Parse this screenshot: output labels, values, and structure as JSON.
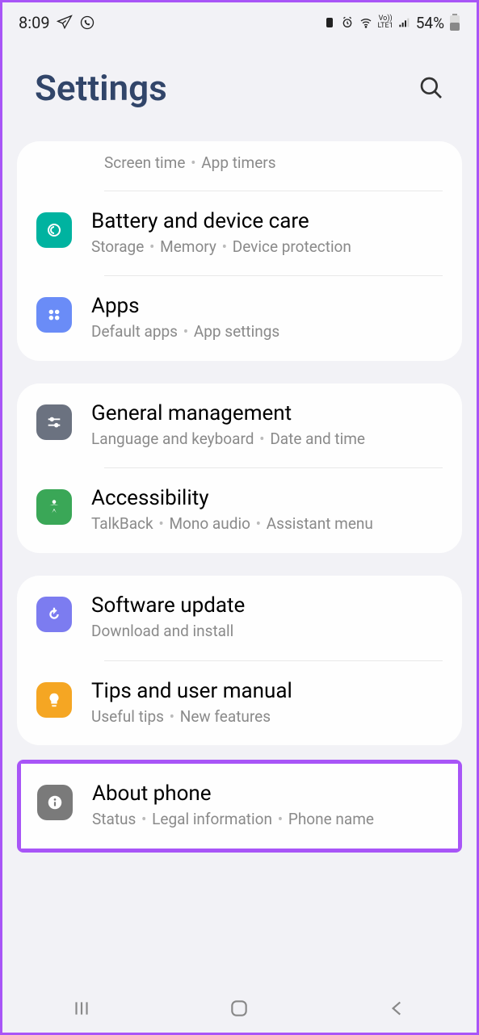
{
  "status": {
    "time": "8:09",
    "battery": "54%",
    "lte": "LTE1",
    "vo": "Vo))"
  },
  "header": {
    "title": "Settings"
  },
  "group1": {
    "digital": {
      "sub1": "Screen time",
      "sub2": "App timers"
    },
    "battery": {
      "title": "Battery and device care",
      "sub1": "Storage",
      "sub2": "Memory",
      "sub3": "Device protection"
    },
    "apps": {
      "title": "Apps",
      "sub1": "Default apps",
      "sub2": "App settings"
    }
  },
  "group2": {
    "general": {
      "title": "General management",
      "sub1": "Language and keyboard",
      "sub2": "Date and time"
    },
    "accessibility": {
      "title": "Accessibility",
      "sub1": "TalkBack",
      "sub2": "Mono audio",
      "sub3": "Assistant menu"
    }
  },
  "group3": {
    "software": {
      "title": "Software update",
      "sub1": "Download and install"
    },
    "tips": {
      "title": "Tips and user manual",
      "sub1": "Useful tips",
      "sub2": "New features"
    }
  },
  "about": {
    "title": "About phone",
    "sub1": "Status",
    "sub2": "Legal information",
    "sub3": "Phone name"
  }
}
